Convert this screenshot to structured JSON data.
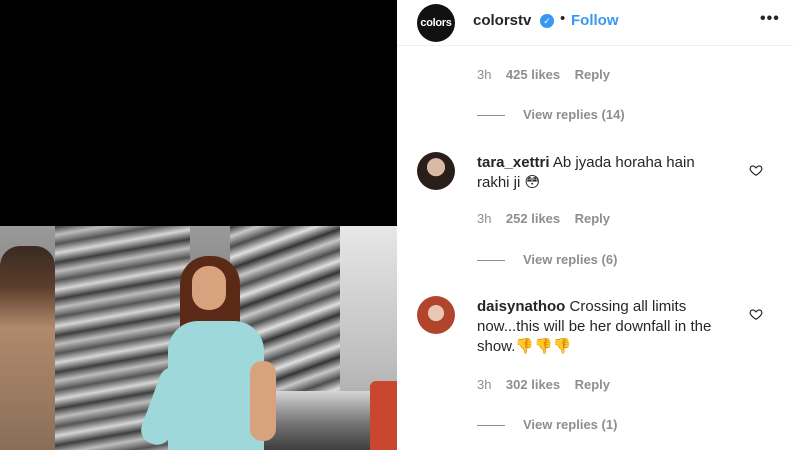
{
  "post_header": {
    "brand_logo_text": "colors",
    "username": "colorstv",
    "separator": "•",
    "follow_label": "Follow",
    "more_label": "•••"
  },
  "comments": {
    "top_comment_meta": {
      "time": "3h",
      "likes": "425 likes",
      "reply": "Reply",
      "view_replies": "View replies (14)"
    },
    "items": [
      {
        "username": "tara_xettri",
        "text": "Ab jyada horaha hain rakhi ji 😳",
        "time": "3h",
        "likes": "252 likes",
        "reply": "Reply",
        "view_replies": "View replies (6)"
      },
      {
        "username": "daisynathoo",
        "text": "Crossing all limits now...this will be her downfall in the show.👎👎👎",
        "time": "3h",
        "likes": "302 likes",
        "reply": "Reply",
        "view_replies": "View replies (1)"
      }
    ]
  },
  "colors": {
    "accent": "#3897f0",
    "secondary_text": "#8e8e8e",
    "primary_text": "#262626"
  },
  "icons": [
    "verified-icon",
    "more-icon",
    "heart-icon"
  ]
}
